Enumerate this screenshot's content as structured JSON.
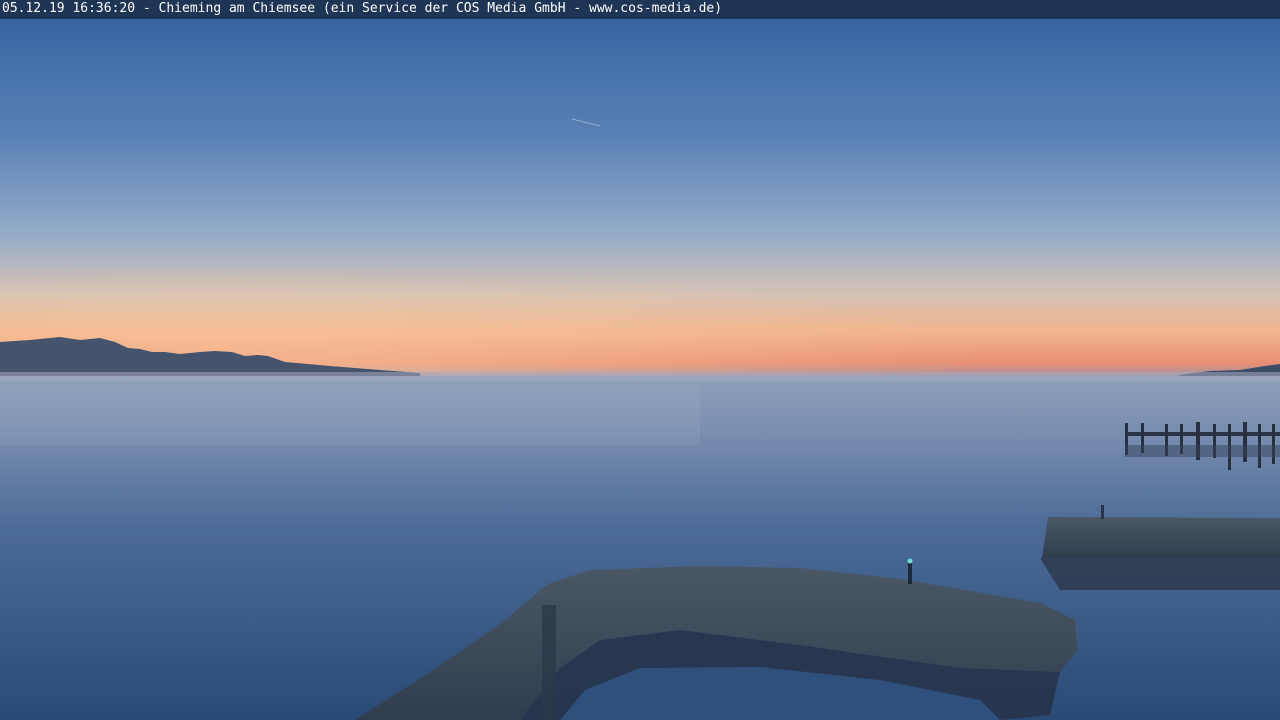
{
  "webcam": {
    "caption": "05.12.19 16:36:20 - Chieming am Chiemsee (ein Service der COS Media GmbH - www.cos-media.de)",
    "caption_bar_color": "#1f3556",
    "caption_text_color": "#ffffff"
  },
  "scene": {
    "description_tags": [
      "sky-gradient",
      "sunset-glow",
      "mountain-silhouette",
      "lake",
      "jetty",
      "harbor-wall",
      "pier-light"
    ],
    "colors": {
      "sky_top": "#2f5f9e",
      "sky_mid": "#8ea8c6",
      "horizon_glow": "#f0a47c",
      "horizon_pink": "#e8937a",
      "mountains": "#3e4f6a",
      "water_near": "#2e4d78",
      "water_far": "#8ea0bd",
      "harbor_wall": "#3b4b5c",
      "pier_light": "#6fe0d8"
    }
  }
}
